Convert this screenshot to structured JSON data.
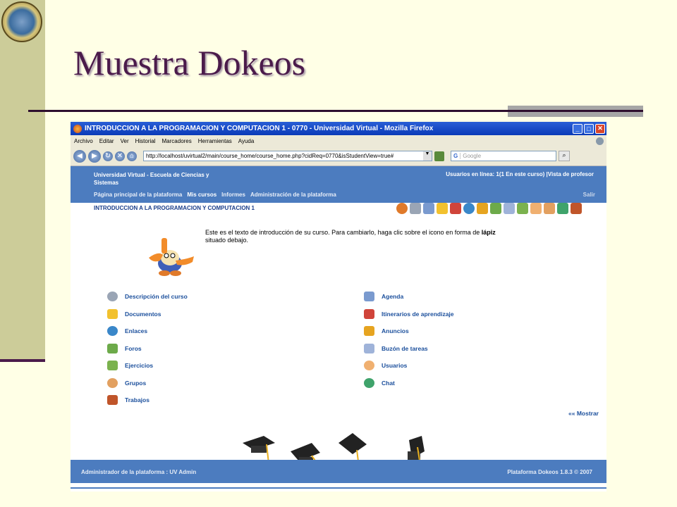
{
  "slide": {
    "title": "Muestra Dokeos"
  },
  "browser": {
    "window_title": "INTRODUCCION A LA PROGRAMACION Y COMPUTACION 1 - 0770 - Universidad Virtual - Mozilla Firefox",
    "menu": [
      "Archivo",
      "Editar",
      "Ver",
      "Historial",
      "Marcadores",
      "Herramientas",
      "Ayuda"
    ],
    "url": "http://localhost/uvirtual2/main/course_home/course_home.php?cidReq=0770&isStudentView=true#",
    "search_placeholder": "Google",
    "search_engine": "G"
  },
  "header": {
    "site_name": "Universidad Virtual - Escuela de Ciencias y Sistemas",
    "online": "Usuarios en línea: 1(1 En este curso) |Vista de profesor",
    "nav": [
      "Página principal de la plataforma",
      "Mis cursos",
      "Informes",
      "Administración de la plataforma"
    ],
    "logout": "Salir"
  },
  "course": {
    "title": "INTRODUCCION A LA PROGRAMACION Y COMPUTACION 1",
    "intro_text": "Este es el texto de introducción de su curso. Para cambiarlo, haga clic sobre el icono en forma de",
    "intro_bold": "lápiz",
    "intro_end": "situado debajo."
  },
  "tools_left": [
    {
      "label": "Descripción del curso",
      "icon": "description-icon",
      "color": "#9AA5B5"
    },
    {
      "label": "Documentos",
      "icon": "folder-icon",
      "color": "#F2C12E"
    },
    {
      "label": "Enlaces",
      "icon": "globe-icon",
      "color": "#3A87C9"
    },
    {
      "label": "Foros",
      "icon": "forum-icon",
      "color": "#6DAA4A"
    },
    {
      "label": "Ejercicios",
      "icon": "exercise-icon",
      "color": "#7BB24E"
    },
    {
      "label": "Grupos",
      "icon": "group-icon",
      "color": "#E2A060"
    },
    {
      "label": "Trabajos",
      "icon": "pencil-icon",
      "color": "#C0552A"
    }
  ],
  "tools_right": [
    {
      "label": "Agenda",
      "icon": "calendar-icon",
      "color": "#7A9ACF"
    },
    {
      "label": "Itinerarios de aprendizaje",
      "icon": "path-icon",
      "color": "#D0443A"
    },
    {
      "label": "Anuncios",
      "icon": "bell-icon",
      "color": "#E6A420"
    },
    {
      "label": "Buzón de tareas",
      "icon": "envelope-icon",
      "color": "#9FB3D9"
    },
    {
      "label": "Usuarios",
      "icon": "user-icon",
      "color": "#F0B070"
    },
    {
      "label": "Chat",
      "icon": "chat-icon",
      "color": "#3FA36B"
    }
  ],
  "show_link": "«« Mostrar",
  "footer": {
    "left": "Administrador de la plataforma : UV Admin",
    "right": "Plataforma Dokeos 1.8.3 © 2007"
  }
}
